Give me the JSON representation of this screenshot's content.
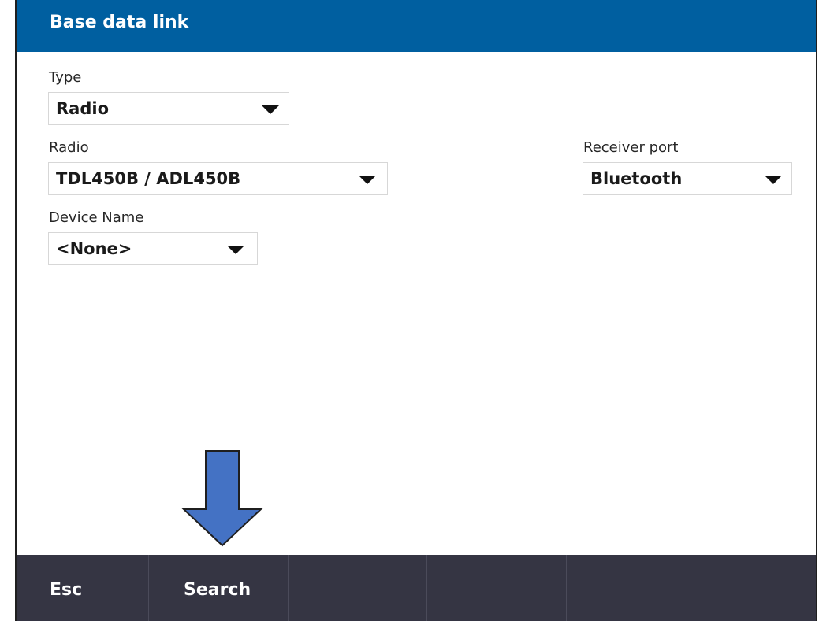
{
  "title": "Base data link",
  "fields": {
    "type": {
      "label": "Type",
      "value": "Radio"
    },
    "radio": {
      "label": "Radio",
      "value": "TDL450B / ADL450B"
    },
    "receiver_port": {
      "label": "Receiver port",
      "value": "Bluetooth"
    },
    "device_name": {
      "label": "Device Name",
      "value": "<None>"
    }
  },
  "softkeys": [
    "Esc",
    "Search",
    "",
    "",
    "",
    ""
  ],
  "colors": {
    "title_bar": "#005fa0",
    "softkey_bar": "#353543",
    "annotation_arrow": "#4472c4"
  },
  "annotation": {
    "icon": "down-arrow-icon"
  }
}
